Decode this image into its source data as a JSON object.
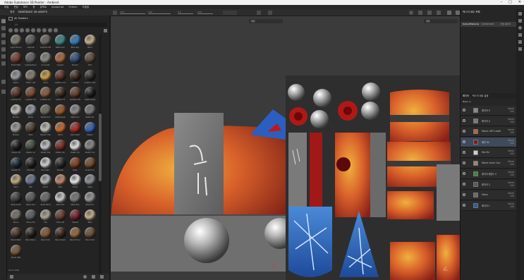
{
  "window": {
    "title": "Adobe Substance 3D Painter - Ambient"
  },
  "menu": [
    "파일",
    "편집",
    "모드",
    "창",
    "뷰포트",
    "Javascript",
    "Python",
    "도움말"
  ],
  "toolbar": {
    "v1": "100",
    "v2": "100",
    "v3": "0.5",
    "v4": "100"
  },
  "shelf": {
    "tabs": [
      "에셋",
      "SUBSTANCE 3D ASSETS"
    ],
    "search_placeholder": "검색",
    "filter": "All Shaders",
    "footer": "Wood 006",
    "materials": [
      [
        "Aged Stone",
        "Asphalt",
        "Asphalt Old",
        "Bathroom",
        "Blue Sky",
        "Bone"
      ],
      [
        "Brick Wall",
        "Cobblestone",
        "Concrete",
        "Copper",
        "Denim",
        "Dirt"
      ],
      [
        "Fabric",
        "Fabric Old",
        "Gold",
        "Leather Lux",
        "Leather",
        "Leather Old"
      ],
      [
        "Leather Ro",
        "Leather Sa",
        "Leather So",
        "Leather Tr",
        "Leather Ws",
        "Leatherette"
      ],
      [
        "Marble",
        "Metal",
        "Metal Dirt",
        "Metal Rust",
        "Metal Scr",
        "Metal Str"
      ],
      [
        "Mosaic",
        "Mud",
        "Mosaic Tile",
        "Paint",
        "Paint Red",
        "Plastic"
      ],
      [
        "Plastic Bl",
        "Plastic Gr",
        "Plastic Ma",
        "Plastic Ru",
        "Plastic Sh",
        "Plastic Sm"
      ],
      [
        "Plastic Ts",
        "Polished",
        "Porcelain",
        "Rubber",
        "Rust",
        "Rust Fine"
      ],
      [
        "Sand",
        "Silk",
        "Silver",
        "Skin",
        "Snow",
        "Steel"
      ],
      [
        "Steel Dark",
        "Steel Gun",
        "Steel Paint",
        "Steel Pol",
        "Steel Rou",
        "Steel Scr"
      ],
      [
        "Stone",
        "Stone Flo",
        "Tile",
        "Tiles Old",
        "Velvet",
        "Wax"
      ],
      [
        "Wood Bark",
        "Wood Burn",
        "Wood Chi",
        "Wood Dark",
        "Wood Floor",
        "Wood Old"
      ],
      [
        "Wood 006"
      ]
    ],
    "colors": [
      [
        "#7f7a6d",
        "#5a5a5a",
        "#6a6660",
        "#3d8c8a",
        "#2e7fc0",
        "#c9b38a"
      ],
      [
        "#7a3a2c",
        "#5f5f5f",
        "#8a8a84",
        "#b4683c",
        "#2f4f7a",
        "#5f4b35"
      ],
      [
        "#9c9fa4",
        "#8a8073",
        "#d3a640",
        "#5c2e22",
        "#3e2a21",
        "#2d2a28"
      ],
      [
        "#5a3326",
        "#7b4a30",
        "#8c5c3c",
        "#3d2a1e",
        "#6a3f2b",
        "#1d1d1d"
      ],
      [
        "#c7c3bb",
        "#9a9ea6",
        "#6d6a60",
        "#9b5a2a",
        "#8e8e8e",
        "#7b7b7b"
      ],
      [
        "#a6a199",
        "#4d3b2c",
        "#c9c6c0",
        "#cc6a2a",
        "#a82820",
        "#3562b8"
      ],
      [
        "#1e1e1e",
        "#3e4c3a",
        "#c9c9c9",
        "#7a2a20",
        "#e6e6e6",
        "#8a8a8a"
      ],
      [
        "#1a2a3a",
        "#202020",
        "#d8d8d8",
        "#262626",
        "#8a3d1a",
        "#7a4a2a"
      ],
      [
        "#c7ae80",
        "#6e7a95",
        "#b8b8b8",
        "#c48a70",
        "#eeeeee",
        "#8f9398"
      ],
      [
        "#3c3c3c",
        "#5a5a5a",
        "#6a6a6a",
        "#d0d0d0",
        "#7c7c7c",
        "#9a9a9a"
      ],
      [
        "#7a746a",
        "#5a5e60",
        "#b0a89a",
        "#6a3a30",
        "#7a1e2a",
        "#c6b590"
      ],
      [
        "#4a3424",
        "#2a1e18",
        "#8a5a32",
        "#3c2618",
        "#9a6a3e",
        "#6e5038"
      ],
      [
        "#7a5838"
      ]
    ]
  },
  "viewport": {
    "mode3d": "재질",
    "mode2d": "재질"
  },
  "right": {
    "panel_title": "텍스처 세트 목록",
    "texture_set": "DefaultMaterial",
    "ts_res": "2048x2048",
    "ts_shader": "기본 셰이더",
    "tabs": [
      "레이어",
      "텍스처 세트 설정"
    ],
    "base_label": "Base co",
    "layers": [
      {
        "name": "레이어 5",
        "blend": "Norm",
        "op": "100",
        "thumb": "#8a8a8a"
      },
      {
        "name": "레이어 4",
        "blend": "Norm",
        "op": "100",
        "thumb": "#7a7a7a"
      },
      {
        "name": "Fabric UDT Leath",
        "blend": "Norm",
        "op": "100",
        "thumb": "#b06a30"
      },
      {
        "name": "패턴 fill",
        "blend": "Norm",
        "op": "100",
        "thumb": "#7a2020"
      },
      {
        "name": "Mix Str",
        "blend": "Norm",
        "op": "100",
        "thumb": "#d0d0d0"
      },
      {
        "name": "Fabric Linen Cou",
        "blend": "Norm",
        "op": "100",
        "thumb": "#9a8a6a"
      },
      {
        "name": "레이어 패턴2 4",
        "blend": "Norm",
        "op": "100",
        "thumb": "#3a8a3a"
      },
      {
        "name": "레이어 2",
        "blend": "Norm",
        "op": "100",
        "thumb": "#5a5a5a"
      },
      {
        "name": "Glass",
        "blend": "Norm",
        "op": "100",
        "thumb": "#6a6a6a"
      },
      {
        "name": "레이어 1",
        "blend": "Norm",
        "op": "100",
        "thumb": "#2e5aa0"
      }
    ]
  }
}
